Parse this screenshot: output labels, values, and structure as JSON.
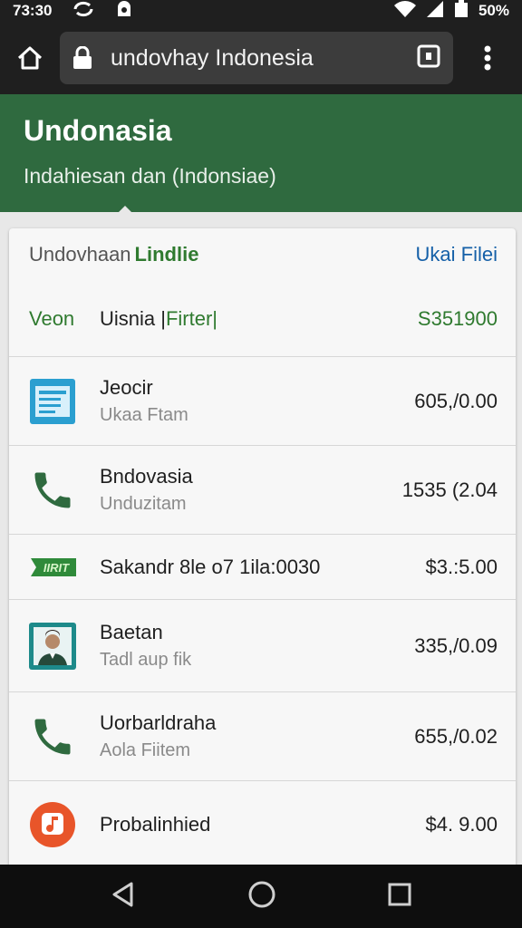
{
  "status_bar": {
    "time": "73:30",
    "battery": "50%",
    "icons": [
      "sync-icon",
      "notification-icon",
      "wifi-icon",
      "signal-icon",
      "battery-icon"
    ]
  },
  "browser": {
    "url": "undovhay Indonesia",
    "icons": [
      "home-icon",
      "lock-icon",
      "tab-switcher-icon",
      "more-menu-icon"
    ]
  },
  "header": {
    "title": "Undonasia",
    "subtitle": "Indahiesan dan (Indonsiae)",
    "background": "#2f6a3f"
  },
  "card": {
    "heading_primary": "Undovhaan",
    "heading_accent": "Lindlie",
    "link": "Ukai Filei",
    "summary": {
      "tag": "Veon",
      "name": "Uisnia |",
      "filter": "Firter|",
      "amount": "S351900"
    },
    "rows": [
      {
        "title": "Jeocir",
        "subtitle": "Ukaa Ftam",
        "amount": "605,/0.00",
        "icon": "document-icon"
      },
      {
        "title": "Bndovasia",
        "subtitle": "Unduzitam",
        "amount": "1535 (2.04",
        "icon": "phone-icon"
      },
      {
        "title": "Sakandr 8le o7 1ila:0030",
        "subtitle": "",
        "amount": "$3.:5.00",
        "icon": "ticket-icon",
        "badge": "IIRIT"
      },
      {
        "title": "Baetan",
        "subtitle": "Tadl aup fik",
        "amount": "335,/0.09",
        "icon": "profile-photo-icon"
      },
      {
        "title": "Uorbarldraha",
        "subtitle": "Aola Fiitem",
        "amount": "655,/0.02",
        "icon": "phone-icon"
      },
      {
        "title": "Probalinhied",
        "subtitle": "",
        "amount": "$4. 9.00",
        "icon": "music-app-icon"
      }
    ]
  },
  "nav_bar": {
    "icons": [
      "back-icon",
      "home-circle-icon",
      "recents-icon"
    ]
  },
  "colors": {
    "accent_green": "#2f7a2f",
    "link_blue": "#1560a8",
    "toolbar": "#1f1f1f"
  }
}
